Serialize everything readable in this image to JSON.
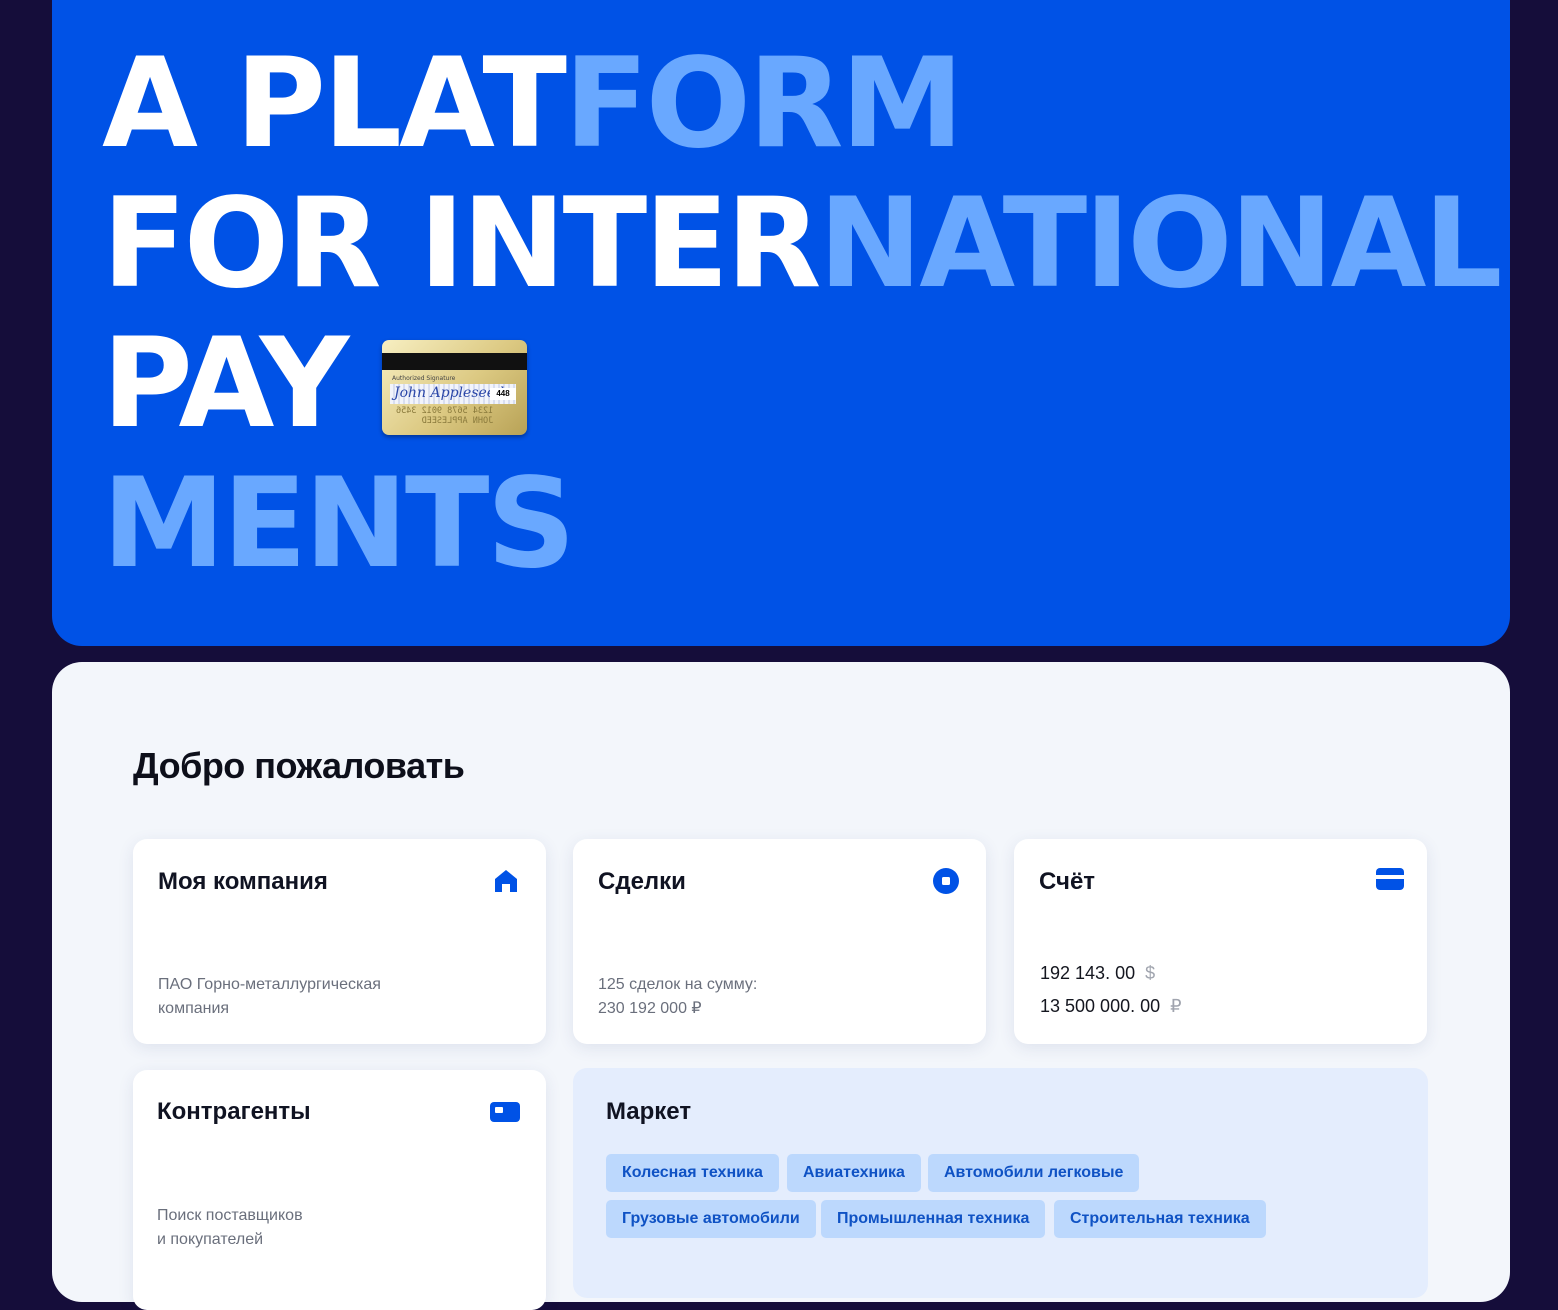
{
  "hero": {
    "line1_white": "A PLAT",
    "line1_light": "FORM",
    "line2_white": "FOR INTER",
    "line2_light": "NATIONAL",
    "line3_white": "PAY",
    "line4_light": "MENTS",
    "card_image": {
      "authorized": "Authorized Signature",
      "signature": "John Appleseed",
      "cvv": "448",
      "mirror_number": "1234 5678 9012 3456",
      "mirror_name": "JOHN APPLESEED"
    },
    "colors": {
      "background": "#0052e6",
      "light_text": "#69a8ff",
      "white_text": "#ffffff"
    }
  },
  "dashboard": {
    "welcome": "Добро пожаловать",
    "company": {
      "title": "Моя компания",
      "icon": "home-icon",
      "desc_line1": "ПАО Горно-металлургическая",
      "desc_line2": "компания"
    },
    "deals": {
      "title": "Сделки",
      "icon": "deals-icon",
      "desc_line1": "125 сделок на сумму:",
      "desc_line2": "230 192 000 ₽"
    },
    "account": {
      "title": "Счёт",
      "icon": "card-icon",
      "amount_usd": "192 143. 00",
      "currency_usd": "$",
      "amount_rub": "13 500 000. 00",
      "currency_rub": "₽"
    },
    "counterparties": {
      "title": "Контрагенты",
      "icon": "id-card-icon",
      "desc_line1": "Поиск поставщиков",
      "desc_line2": "и покупателей"
    },
    "market": {
      "title": "Маркет",
      "tags": [
        "Колесная техника",
        "Авиатехника",
        "Автомобили легковые",
        "Грузовые автомобили",
        "Промышленная техника",
        "Строительная техника"
      ]
    },
    "colors": {
      "accent": "#0052e6",
      "panel": "#f3f6fb",
      "tag_bg": "#bcd8fd",
      "tag_text": "#0f52c4"
    }
  }
}
